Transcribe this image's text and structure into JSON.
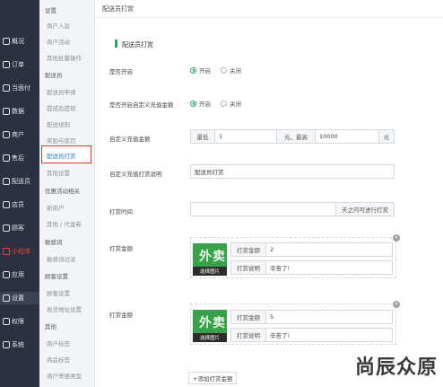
{
  "sidebar": {
    "items": [
      {
        "label": "概况",
        "icon": "overview-icon"
      },
      {
        "label": "订单",
        "icon": "order-icon"
      },
      {
        "label": "当面付",
        "icon": "pay-icon"
      },
      {
        "label": "数据",
        "icon": "data-icon"
      },
      {
        "label": "商户",
        "icon": "merchant-icon"
      },
      {
        "label": "售后",
        "icon": "aftersale-icon"
      },
      {
        "label": "配送员",
        "icon": "courier-icon"
      },
      {
        "label": "店员",
        "icon": "clerk-icon"
      },
      {
        "label": "顾客",
        "icon": "customer-icon"
      },
      {
        "label": "小程序",
        "icon": "miniapp-icon"
      },
      {
        "label": "应用",
        "icon": "apps-icon"
      },
      {
        "label": "设置",
        "icon": "gear-icon"
      },
      {
        "label": "权限",
        "icon": "permission-icon"
      },
      {
        "label": "系统",
        "icon": "system-icon"
      }
    ]
  },
  "subnav": {
    "items": [
      {
        "label": "设置",
        "head": true
      },
      {
        "label": "商户入驻",
        "head": false
      },
      {
        "label": "商户活动",
        "head": false
      },
      {
        "label": "其他批量操作",
        "head": false
      },
      {
        "label": "配送员",
        "head": true
      },
      {
        "label": "配送员申请",
        "head": false
      },
      {
        "label": "提成及提现",
        "head": false
      },
      {
        "label": "配送规则",
        "head": false
      },
      {
        "label": "奖励与惩罚",
        "head": false
      },
      {
        "label": "配送员打赏",
        "head": false,
        "active": true
      },
      {
        "label": "其他设置",
        "head": false
      },
      {
        "label": "优惠活动相关",
        "head": true
      },
      {
        "label": "新用户",
        "head": false
      },
      {
        "label": "其他 / 代金券",
        "head": false
      },
      {
        "label": "敏感词",
        "head": true
      },
      {
        "label": "敏感词过滤",
        "head": false
      },
      {
        "label": "顾客设置",
        "head": true
      },
      {
        "label": "顾客设置",
        "head": false
      },
      {
        "label": "收货地址设置",
        "head": false
      },
      {
        "label": "其他",
        "head": true
      },
      {
        "label": "商户标签",
        "head": false
      },
      {
        "label": "商品标签",
        "head": false
      },
      {
        "label": "商户举报类型",
        "head": false
      }
    ]
  },
  "breadcrumb": "配送员打赏",
  "section_title": "配送员打赏",
  "form": {
    "enable_label": "是否开启",
    "enable_on": "开启",
    "enable_off": "关闭",
    "custom_amount_label": "是否开启自定义充值金额",
    "custom_on": "开启",
    "custom_off": "关闭",
    "range_label": "自定义充值金额",
    "min_prefix": "最低",
    "min_value": "1",
    "unit1": "元，最高",
    "max_value": "10000",
    "unit2": "元",
    "desc_label": "自定义充值打赏说明",
    "desc_value": "配送员打赏",
    "time_label": "打赏时间",
    "time_suffix": "天之内可进行打赏",
    "rewards": [
      {
        "label": "打赏金额",
        "amount_label": "打赏金额",
        "amount": "2",
        "note_label": "打赏说明",
        "note": "辛苦了!",
        "img_text": "外卖",
        "img_caption": "选择图片"
      },
      {
        "label": "打赏金额",
        "amount_label": "打赏金额",
        "amount": "5",
        "note_label": "打赏说明",
        "note": "辛苦了!",
        "img_text": "外卖",
        "img_caption": "选择图片"
      }
    ],
    "add_button": "+添加打赏金额"
  },
  "watermark": "尚辰众原",
  "colors": {
    "sidebar": "#2b3140",
    "accent": "#2fa36b",
    "highlight_border": "#d73a3a",
    "link": "#2f7ec6"
  }
}
